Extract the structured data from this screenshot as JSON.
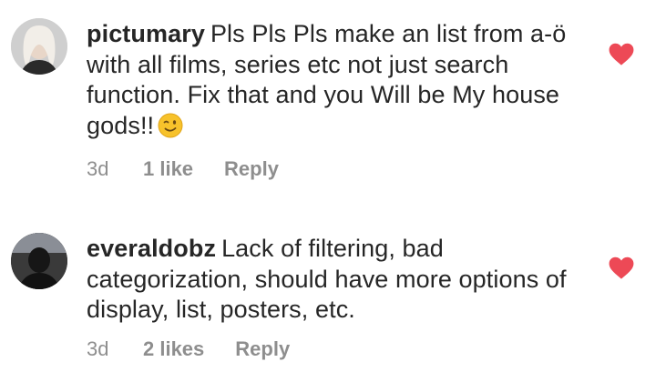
{
  "comments": [
    {
      "username": "pictumary",
      "text": "Pls Pls Pls make an list from a-ö with all films, series etc not just search function. Fix that and you Will be My house gods!!",
      "emoji": "winking-face-emoji",
      "time": "3d",
      "likes": "1 like",
      "reply": "Reply",
      "liked": true
    },
    {
      "username": "everaldobz",
      "text": "Lack of filtering, bad categorization, should have more options of display, list, posters, etc.",
      "time": "3d",
      "likes": "2 likes",
      "reply": "Reply",
      "liked": true
    }
  ],
  "colors": {
    "heart": "#ed4956",
    "meta": "#8e8e8e",
    "text": "#262626"
  }
}
